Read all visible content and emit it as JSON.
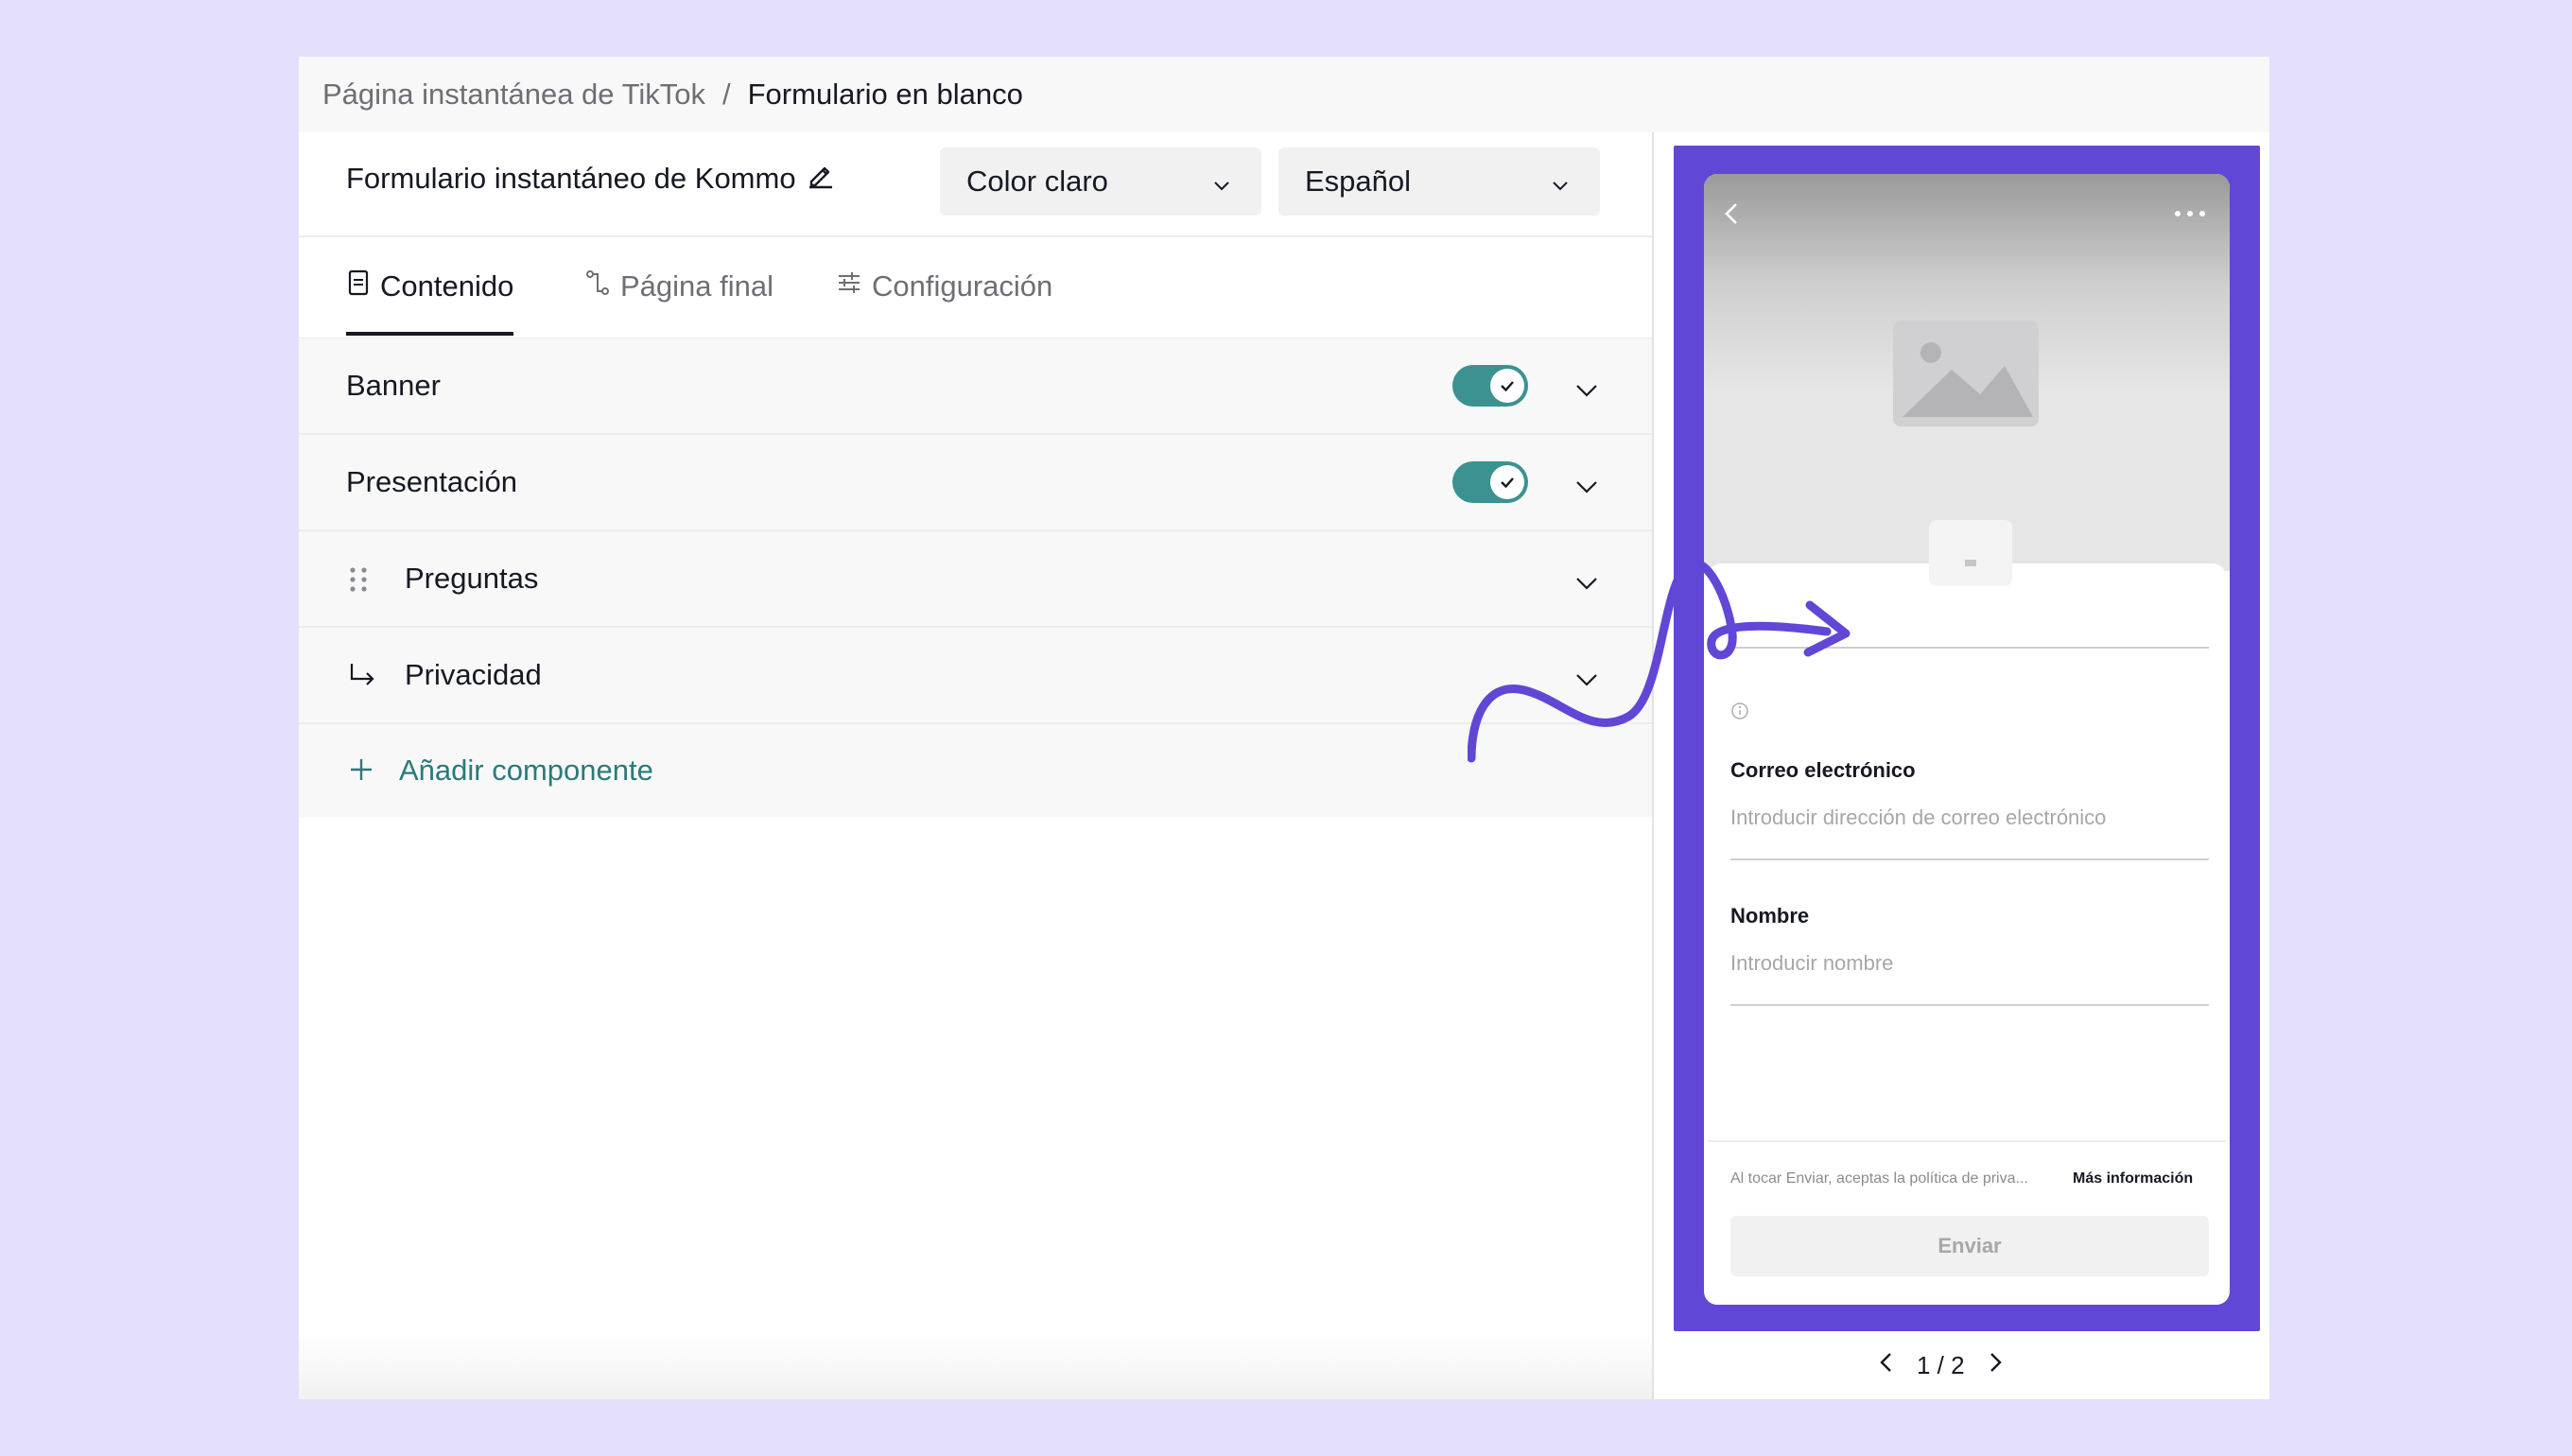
{
  "breadcrumb": {
    "parent": "Página instantánea de TikTok",
    "separator": "/",
    "current": "Formulario en blanco"
  },
  "form": {
    "title": "Formulario instantáneo de Kommo",
    "theme_select": "Color claro",
    "language_select": "Español"
  },
  "tabs": [
    {
      "label": "Contenido",
      "active": true
    },
    {
      "label": "Página final",
      "active": false
    },
    {
      "label": "Configuración",
      "active": false
    }
  ],
  "components": [
    {
      "label": "Banner",
      "toggle_on": true
    },
    {
      "label": "Presentación",
      "toggle_on": true
    },
    {
      "label": "Preguntas"
    },
    {
      "label": "Privacidad"
    }
  ],
  "add_component_label": "Añadir componente",
  "preview": {
    "fields": [
      {
        "label": "Correo electrónico",
        "placeholder": "Introducir dirección de correo electrónico"
      },
      {
        "label": "Nombre",
        "placeholder": "Introducir nombre"
      }
    ],
    "legal_text": "Al tocar Enviar, aceptas la política de priva...",
    "legal_link": "Más información",
    "submit_label": "Enviar",
    "pager": "1 / 2"
  },
  "colors": {
    "accent_teal": "#3c9290",
    "annotation_purple": "#6246d6",
    "background": "#e4dffc"
  }
}
